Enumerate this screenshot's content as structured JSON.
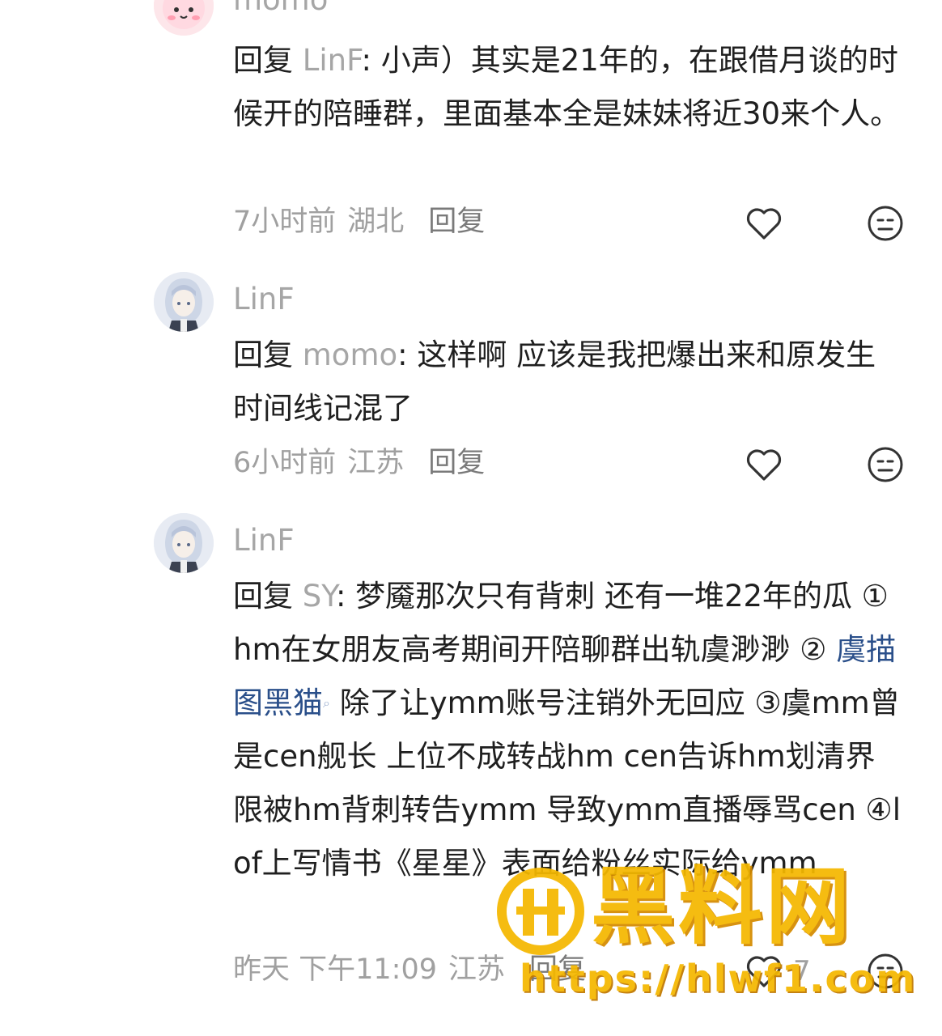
{
  "comments": [
    {
      "username": "momo",
      "reply_prefix": "回复 ",
      "mention": "LinF",
      "body": ": 小声）其实是21年的，在跟借月谈的时候开的陪睡群，里面基本全是妹妹将近30来个人。",
      "time": "7小时前",
      "location": "湖北",
      "reply_label": "回复"
    },
    {
      "username": "LinF",
      "reply_prefix": "回复 ",
      "mention": "momo",
      "body": ": 这样啊 应该是我把爆出来和原发生时间线记混了",
      "time": "6小时前",
      "location": "江苏",
      "reply_label": "回复"
    },
    {
      "username": "LinF",
      "reply_prefix": "回复 ",
      "mention": "SY",
      "body_a": ": 梦魇那次只有背刺 还有一堆22年的瓜 ①hm在女朋友高考期间开陪聊群出轨虞渺渺 ② ",
      "link": "虞描图黑猫",
      "body_b": " 除了让ymm账号注销外无回应 ③虞mm曾是cen舰长 上位不成转战hm cen告诉hm划清界限被hm背刺转告ymm 导致ymm直播辱骂cen ④lof上写情书《星星》表面给粉丝实际给ymm",
      "time": "昨天 下午11:09",
      "location": "江苏",
      "reply_label": "回复",
      "like_count": "7"
    }
  ],
  "icons": {
    "like": "heart-outline-icon",
    "dislike": "neutral-face-icon",
    "link_search": "search-icon"
  },
  "watermark": {
    "title": "黑料网",
    "url": "https://hlwf1.com"
  },
  "colors": {
    "username": "#a6a6a6",
    "body": "#1f1f1f",
    "link": "#2a4f8a",
    "watermark": "#f5b800"
  }
}
